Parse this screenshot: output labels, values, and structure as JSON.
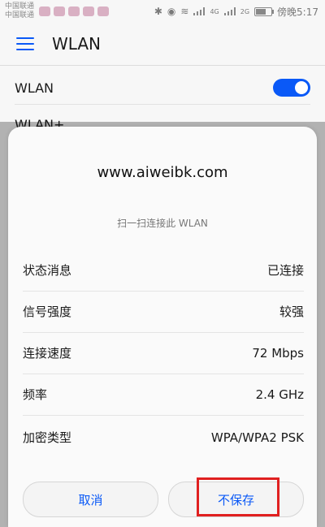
{
  "statusbar": {
    "carrier1": "中国联通",
    "carrier2": "中国联通",
    "signal_label": "4G",
    "signal_label2": "2G",
    "time": "傍晚5:17"
  },
  "header": {
    "title": "WLAN"
  },
  "settings": {
    "wlan_label": "WLAN",
    "wlan_enabled": true,
    "wlanplus_label": "WLAN+"
  },
  "dialog": {
    "qr_title": "www.aiweibk.com",
    "scan_hint": "扫一扫连接此 WLAN",
    "rows": [
      {
        "label": "状态消息",
        "value": "已连接"
      },
      {
        "label": "信号强度",
        "value": "较强"
      },
      {
        "label": "连接速度",
        "value": "72 Mbps"
      },
      {
        "label": "频率",
        "value": "2.4 GHz"
      },
      {
        "label": "加密类型",
        "value": "WPA/WPA2 PSK"
      }
    ],
    "cancel_label": "取消",
    "forget_label": "不保存"
  },
  "colors": {
    "accent": "#0a59f7",
    "highlight": "#e02020"
  }
}
